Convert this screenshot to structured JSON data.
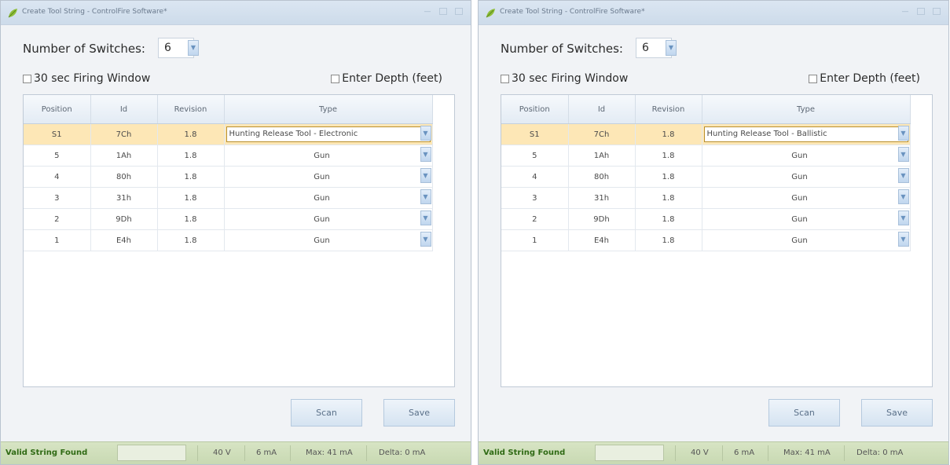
{
  "windows": [
    {
      "title": "Create Tool String - ControlFire Software*",
      "switch_label": "Number of Switches:",
      "switch_value": "6",
      "firing_window_label": "30 sec Firing Window",
      "depth_label": "Enter Depth (feet)",
      "columns": [
        "Position",
        "Id",
        "Revision",
        "Type"
      ],
      "rows": [
        {
          "position": "S1",
          "id": "7Ch",
          "revision": "1.8",
          "type": "Hunting Release Tool - Electronic",
          "selected": true
        },
        {
          "position": "5",
          "id": "1Ah",
          "revision": "1.8",
          "type": "Gun"
        },
        {
          "position": "4",
          "id": "80h",
          "revision": "1.8",
          "type": "Gun"
        },
        {
          "position": "3",
          "id": "31h",
          "revision": "1.8",
          "type": "Gun"
        },
        {
          "position": "2",
          "id": "9Dh",
          "revision": "1.8",
          "type": "Gun"
        },
        {
          "position": "1",
          "id": "E4h",
          "revision": "1.8",
          "type": "Gun"
        }
      ],
      "scan_label": "Scan",
      "save_label": "Save",
      "status": {
        "valid": "Valid String Found",
        "volts": "40 V",
        "current": "6 mA",
        "max": "Max: 41 mA",
        "delta": "Delta: 0 mA"
      }
    },
    {
      "title": "Create Tool String - ControlFire Software*",
      "switch_label": "Number of Switches:",
      "switch_value": "6",
      "firing_window_label": "30 sec Firing Window",
      "depth_label": "Enter Depth (feet)",
      "columns": [
        "Position",
        "Id",
        "Revision",
        "Type"
      ],
      "rows": [
        {
          "position": "S1",
          "id": "7Ch",
          "revision": "1.8",
          "type": "Hunting Release Tool - Ballistic",
          "selected": true
        },
        {
          "position": "5",
          "id": "1Ah",
          "revision": "1.8",
          "type": "Gun"
        },
        {
          "position": "4",
          "id": "80h",
          "revision": "1.8",
          "type": "Gun"
        },
        {
          "position": "3",
          "id": "31h",
          "revision": "1.8",
          "type": "Gun"
        },
        {
          "position": "2",
          "id": "9Dh",
          "revision": "1.8",
          "type": "Gun"
        },
        {
          "position": "1",
          "id": "E4h",
          "revision": "1.8",
          "type": "Gun"
        }
      ],
      "scan_label": "Scan",
      "save_label": "Save",
      "status": {
        "valid": "Valid String Found",
        "volts": "40 V",
        "current": "6 mA",
        "max": "Max: 41 mA",
        "delta": "Delta: 0 mA"
      }
    }
  ],
  "colors": {
    "selected_row": "#fde7b6",
    "status_bar": "#c8d9b2",
    "valid_text": "#2f6a14"
  },
  "icons": {
    "app": "leaf-icon",
    "dropdown": "chevron-down-icon"
  }
}
